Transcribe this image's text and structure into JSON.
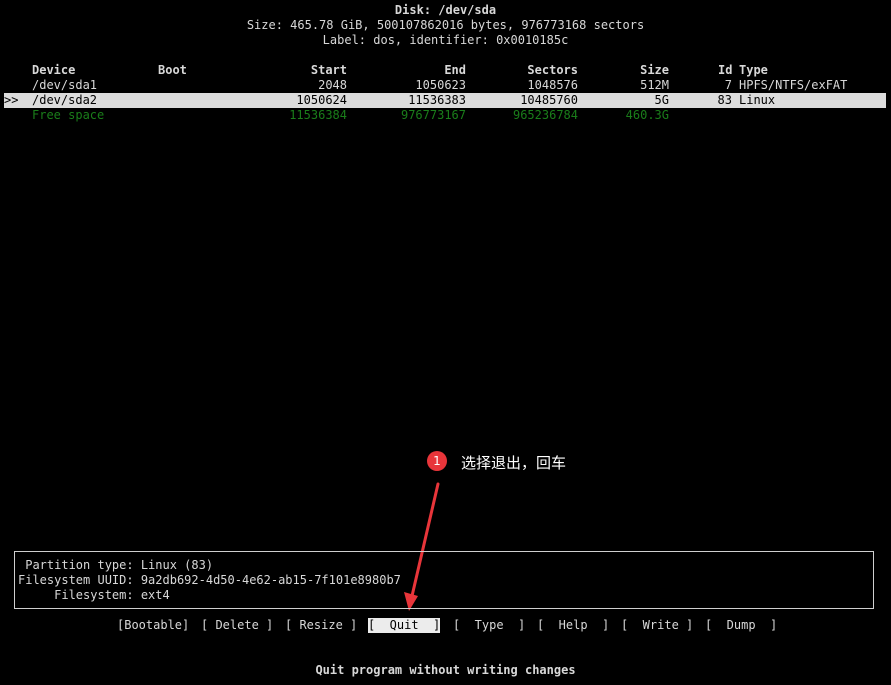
{
  "header": {
    "title": "Disk: /dev/sda",
    "size_line": "Size: 465.78 GiB, 500107862016 bytes, 976773168 sectors",
    "label_line": "Label: dos, identifier: 0x0010185c"
  },
  "table": {
    "columns": {
      "device": "Device",
      "boot": "Boot",
      "start": "Start",
      "end": "End",
      "sectors": "Sectors",
      "size": "Size",
      "id": "Id",
      "type": "Type"
    },
    "rows": [
      {
        "marker": "",
        "device": "/dev/sda1",
        "boot": "",
        "start": "2048",
        "end": "1050623",
        "sectors": "1048576",
        "size": "512M",
        "id": "7",
        "type": "HPFS/NTFS/exFAT"
      },
      {
        "marker": ">>",
        "device": "/dev/sda2",
        "boot": "",
        "start": "1050624",
        "end": "11536383",
        "sectors": "10485760",
        "size": "5G",
        "id": "83",
        "type": "Linux"
      },
      {
        "marker": "",
        "device": "Free space",
        "boot": "",
        "start": "11536384",
        "end": "976773167",
        "sectors": "965236784",
        "size": "460.3G",
        "id": "",
        "type": ""
      }
    ]
  },
  "info": {
    "partition_type": " Partition type: Linux (83)",
    "fs_uuid": "Filesystem UUID: 9a2db692-4d50-4e62-ab15-7f101e8980b7",
    "filesystem": "     Filesystem: ext4"
  },
  "menu": {
    "bootable": "[Bootable]",
    "delete": "[ Delete ]",
    "resize": "[ Resize ]",
    "quit": "[  Quit  ]",
    "type": "[  Type  ]",
    "help": "[  Help  ]",
    "write": "[  Write ]",
    "dump": "[  Dump  ]"
  },
  "status": "Quit program without writing changes",
  "annotation": {
    "number": "1",
    "text": "选择退出，回车",
    "color": "#e8353a"
  },
  "colors": {
    "background": "#000000",
    "text": "#d8d8d8",
    "selected_bg": "#dcdcdc",
    "free_space": "#1a7d1a",
    "accent": "#e8353a"
  }
}
